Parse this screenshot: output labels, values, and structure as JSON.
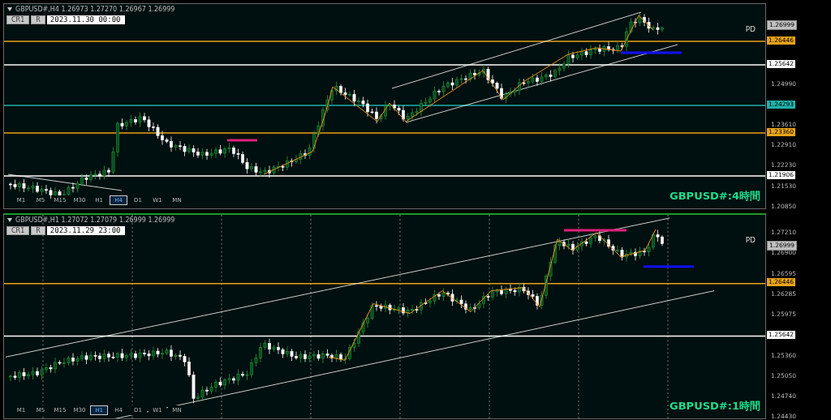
{
  "charts": [
    {
      "header": "GBPUSD#,H4  1.26973 1.27270 1.26967 1.26999",
      "buttons": [
        "CR1",
        "R"
      ],
      "date": "2023.11.30 00:00",
      "label": "PD",
      "title": "GBPUSD#:4時間",
      "timeframes": [
        {
          "label": "M1",
          "selected": false
        },
        {
          "label": "M5",
          "selected": false
        },
        {
          "label": "M15",
          "selected": false
        },
        {
          "label": "M30",
          "selected": false
        },
        {
          "label": "H1",
          "selected": false
        },
        {
          "label": "H4",
          "selected": true
        },
        {
          "label": "D1",
          "selected": false
        },
        {
          "label": "W1",
          "selected": false
        },
        {
          "label": "MN",
          "selected": false
        }
      ],
      "axis_ticks": [
        "1.24990",
        "1.23610",
        "1.22910",
        "1.22230",
        "1.21530",
        "1.20850"
      ],
      "levels": [
        {
          "price": "1.26999",
          "kind": "current",
          "color": "#c0c0c0"
        },
        {
          "price": "1.26446",
          "kind": "line",
          "color": "#e8a317"
        },
        {
          "price": "1.25642",
          "kind": "line",
          "color": "#ffffff"
        },
        {
          "price": "1.24293",
          "kind": "line",
          "color": "#20b2aa"
        },
        {
          "price": "1.23360",
          "kind": "line",
          "color": "#e8a317"
        },
        {
          "price": "1.21906",
          "kind": "line",
          "color": "#ffffff"
        }
      ]
    },
    {
      "header": "GBPUSD#,H1  1.27072 1.27079 1.26999 1.26999",
      "buttons": [
        "CR1",
        "R"
      ],
      "date": "2023.11.29 23:00",
      "label": "PD",
      "title": "GBPUSD#:1時間",
      "timeframes": [
        {
          "label": "M1",
          "selected": false
        },
        {
          "label": "M5",
          "selected": false
        },
        {
          "label": "M15",
          "selected": false
        },
        {
          "label": "M30",
          "selected": false
        },
        {
          "label": "H1",
          "selected": true
        },
        {
          "label": "H4",
          "selected": false
        },
        {
          "label": "D1",
          "selected": false
        },
        {
          "label": "W1",
          "selected": false
        },
        {
          "label": "MN",
          "selected": false
        }
      ],
      "axis_ticks": [
        "1.27210",
        "1.26900",
        "1.26595",
        "1.26285",
        "1.25975",
        "1.25360",
        "1.25050",
        "1.24740",
        "1.24430"
      ],
      "levels": [
        {
          "price": "1.26999",
          "kind": "current",
          "color": "#c0c0c0"
        },
        {
          "price": "1.26446",
          "kind": "line",
          "color": "#e8a317"
        },
        {
          "price": "1.25642",
          "kind": "line",
          "color": "#ffffff"
        }
      ]
    }
  ]
}
